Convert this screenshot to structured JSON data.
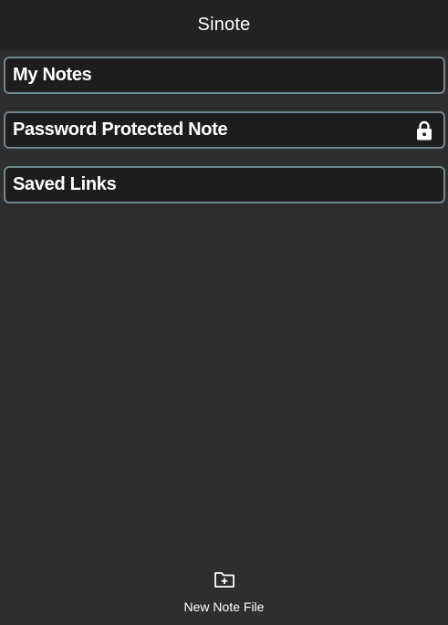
{
  "header": {
    "title": "Sinote"
  },
  "notes": [
    {
      "label": "My Notes",
      "icon": null
    },
    {
      "label": "Password Protected Note",
      "icon": "lock-icon"
    },
    {
      "label": "Saved Links",
      "icon": null
    }
  ],
  "bottom_bar": {
    "new_note_label": "New Note File",
    "icon": "new-folder-icon"
  },
  "colors": {
    "background": "#2e2e2e",
    "header": "#232323",
    "item_background": "#1d1d1d",
    "item_border": "#6f8790",
    "text": "#ffffff"
  }
}
